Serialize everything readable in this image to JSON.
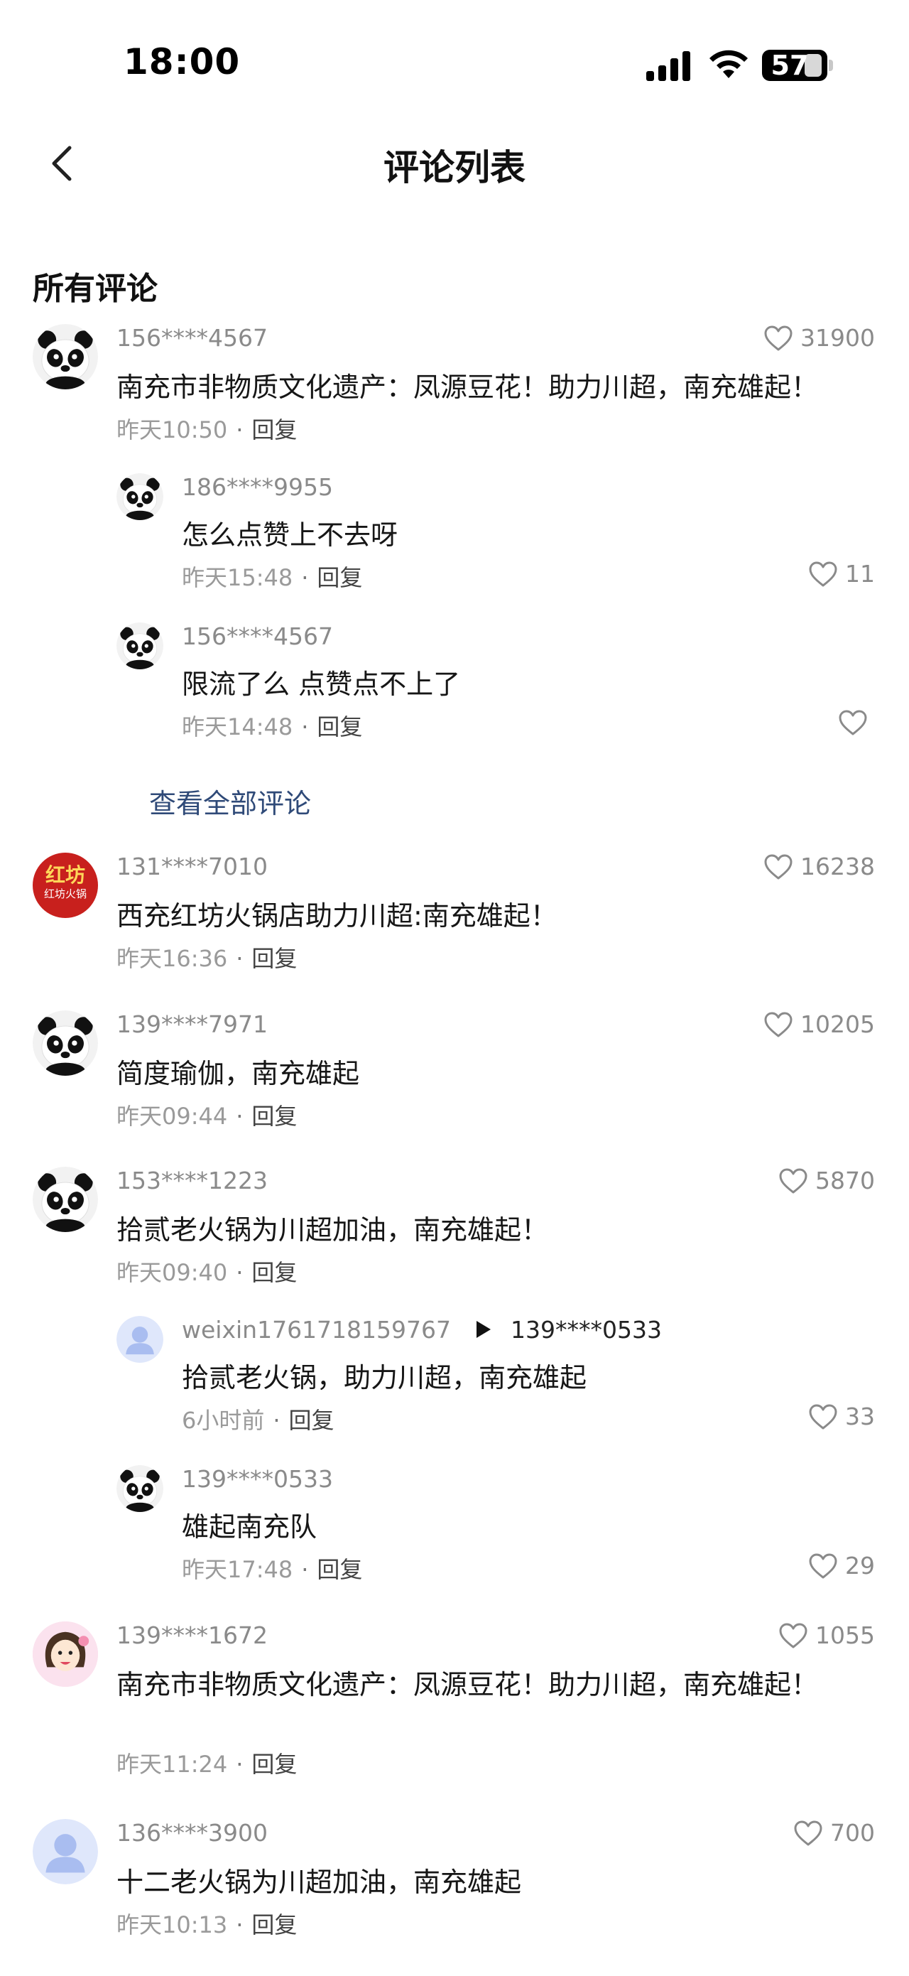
{
  "status_bar": {
    "time": "18:00",
    "battery": "57"
  },
  "nav": {
    "title": "评论列表"
  },
  "section_title": "所有评论",
  "view_all_label": "查看全部评论",
  "reply_label": "回复",
  "comments": [
    {
      "user": "156****4567",
      "likes": "31900",
      "text": "南充市非物质文化遗产：凤源豆花！助力川超，南充雄起！",
      "time": "昨天10:50"
    },
    {
      "user": "186****9955",
      "likes": "11",
      "text": "怎么点赞上不去呀",
      "time": "昨天15:48"
    },
    {
      "user": "156****4567",
      "likes": "",
      "text": "限流了么 点赞点不上了",
      "time": "昨天14:48"
    },
    {
      "user": "131****7010",
      "likes": "16238",
      "text": "西充红坊火锅店助力川超:南充雄起！",
      "time": "昨天16:36"
    },
    {
      "user": "139****7971",
      "likes": "10205",
      "text": "简度瑜伽，南充雄起",
      "time": "昨天09:44"
    },
    {
      "user": "153****1223",
      "likes": "5870",
      "text": "拾贰老火锅为川超加油，南充雄起！",
      "time": "昨天09:40"
    },
    {
      "user": "weixin1761718159767",
      "reply_to": "139****0533",
      "likes": "33",
      "text": "拾贰老火锅，助力川超，南充雄起",
      "time": "6小时前"
    },
    {
      "user": "139****0533",
      "likes": "29",
      "text": "雄起南充队",
      "time": "昨天17:48"
    },
    {
      "user": "139****1672",
      "likes": "1055",
      "text": "南充市非物质文化遗产：凤源豆花！助力川超，南充雄起！",
      "time": "昨天11:24"
    },
    {
      "user": "136****3900",
      "likes": "700",
      "text": "十二老火锅为川超加油，南充雄起",
      "time": "昨天10:13"
    }
  ],
  "logo_text": {
    "top": "红坊",
    "bottom": "红坊火锅"
  }
}
